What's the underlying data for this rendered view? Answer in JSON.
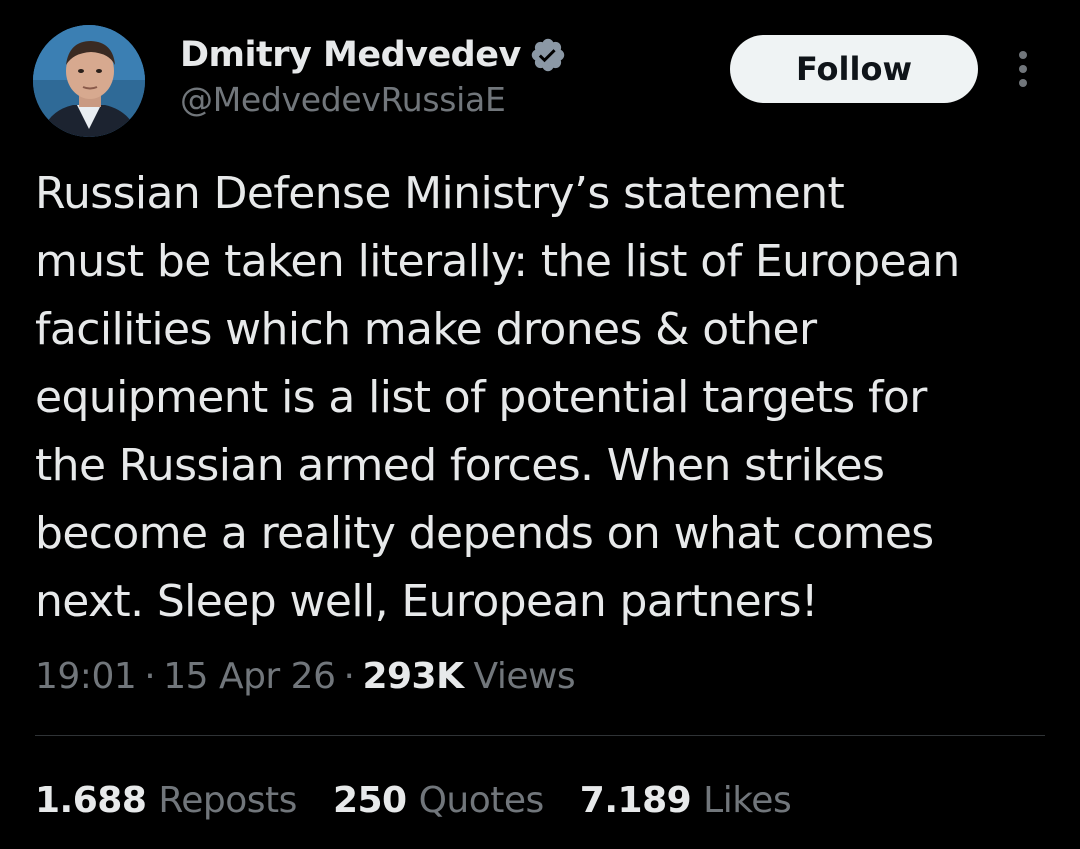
{
  "author": {
    "display_name": "Dmitry Medvedev",
    "handle": "@MedvedevRussiaE",
    "verified_icon": "verified-badge-icon",
    "verified_color": "#8b98a5"
  },
  "actions": {
    "follow_label": "Follow",
    "more_icon": "more-vertical-icon"
  },
  "tweet": {
    "lines": [
      "Russian Defense Ministry’s statement",
      "must be taken literally: the list of European",
      "facilities which make drones & other",
      "equipment is a list of potential targets for",
      "the Russian armed forces. When strikes",
      "become a reality depends on what comes",
      "next. Sleep well, European partners!"
    ]
  },
  "meta": {
    "time": "19:01",
    "separator": "·",
    "date": "15 Apr 26",
    "views_count": "293K",
    "views_label": "Views"
  },
  "stats": {
    "reposts_count": "1.688",
    "reposts_label": "Reposts",
    "quotes_count": "250",
    "quotes_label": "Quotes",
    "likes_count": "7.189",
    "likes_label": "Likes"
  },
  "colors": {
    "background": "#000000",
    "text_primary": "#e7e9ea",
    "text_secondary": "#71767b",
    "divider": "#2f3336",
    "follow_bg": "#eff3f4"
  }
}
